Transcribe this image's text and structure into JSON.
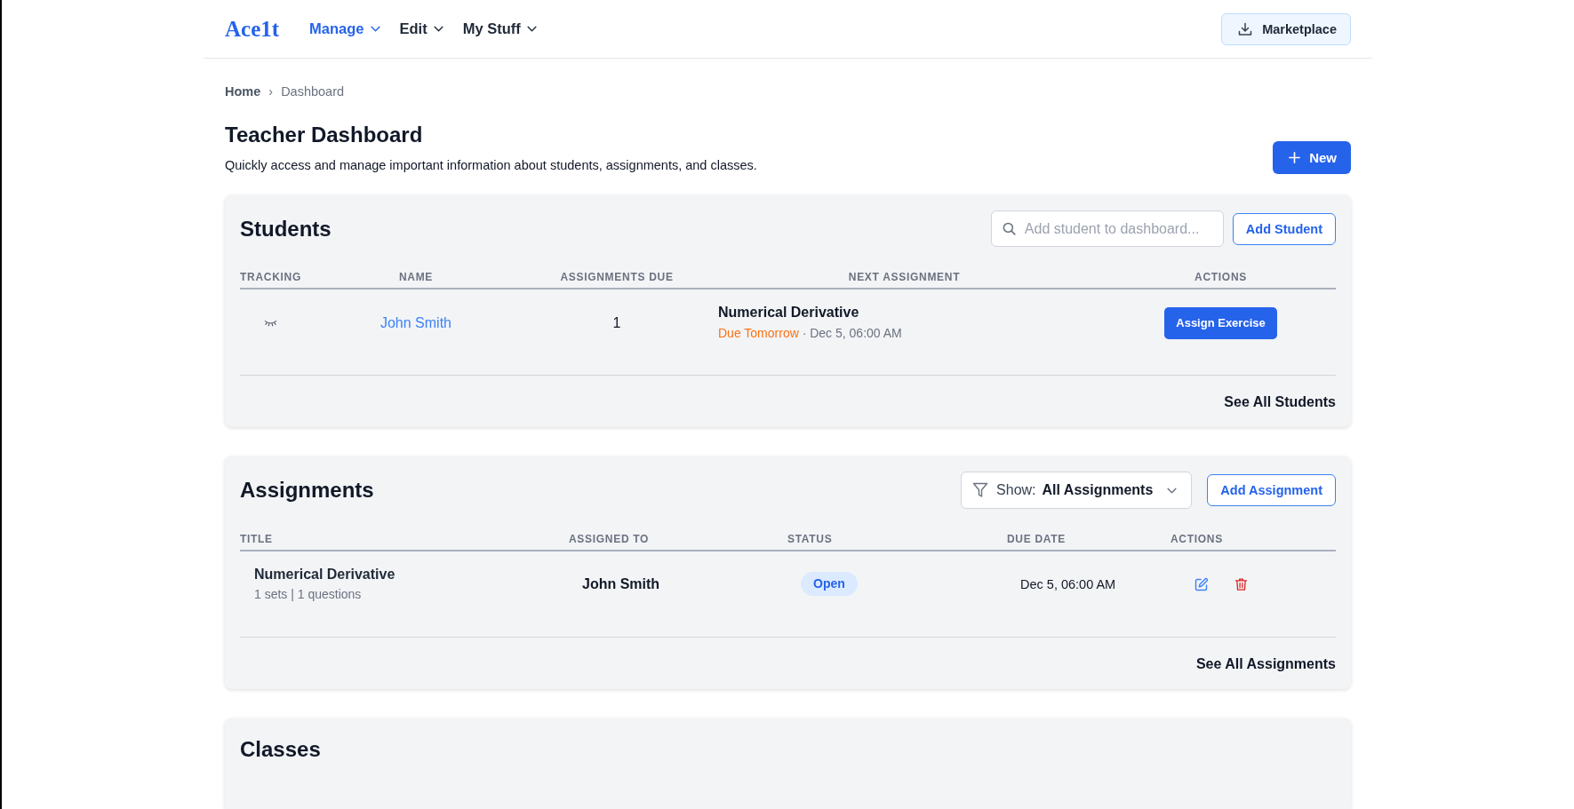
{
  "header": {
    "logo": "Ace1t",
    "nav": [
      {
        "label": "Manage",
        "selected": true
      },
      {
        "label": "Edit",
        "selected": false
      },
      {
        "label": "My Stuff",
        "selected": false
      }
    ],
    "marketplace_button": "Marketplace"
  },
  "breadcrumb": {
    "items": [
      "Home",
      "Dashboard"
    ],
    "separator": "›"
  },
  "page": {
    "title": "Teacher Dashboard",
    "subtitle": "Quickly access and manage important information about students, assignments, and classes.",
    "new_button": "New"
  },
  "students": {
    "title": "Students",
    "search": {
      "placeholder": "Add student to dashboard..."
    },
    "add_button": "Add Student",
    "table": {
      "columns": [
        "TRACKING",
        "NAME",
        "ASSIGNMENTS DUE",
        "NEXT ASSIGNMENT",
        "ACTIONS"
      ],
      "rows": [
        {
          "tracking": false,
          "name": "John Smith",
          "assignments_due": "1",
          "next_assignment": {
            "title": "Numerical Derivative",
            "due_status": "Due Tomorrow",
            "separator": "·",
            "due_date": "Dec 5, 06:00 AM"
          },
          "action": "Assign Exercise"
        }
      ]
    },
    "see_all": "See All Students"
  },
  "assignments": {
    "title": "Assignments",
    "filter": {
      "label": "Show:",
      "value": "All Assignments"
    },
    "add_button": "Add Assignment",
    "table": {
      "columns": [
        "TITLE",
        "ASSIGNED TO",
        "STATUS",
        "DUE DATE",
        "ACTIONS"
      ],
      "rows": [
        {
          "title": "Numerical Derivative",
          "details": "1 sets | 1 questions",
          "assigned_to": "John Smith",
          "status": "Open",
          "due_date": "Dec 5, 06:00 AM"
        }
      ]
    },
    "see_all": "See All Assignments"
  },
  "classes": {
    "title": "Classes"
  }
}
